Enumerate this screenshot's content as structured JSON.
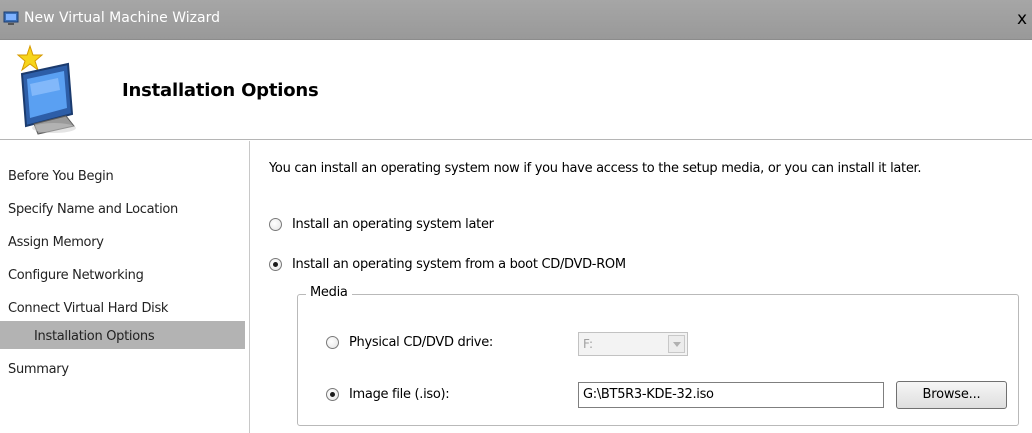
{
  "window": {
    "title": "New Virtual Machine Wizard",
    "close_label": "x"
  },
  "header": {
    "title": "Installation Options"
  },
  "sidebar": {
    "items": [
      {
        "label": "Before You Begin"
      },
      {
        "label": "Specify Name and Location"
      },
      {
        "label": "Assign Memory"
      },
      {
        "label": "Configure Networking"
      },
      {
        "label": "Connect Virtual Hard Disk"
      },
      {
        "label": "Installation Options",
        "active": true
      },
      {
        "label": "Summary"
      }
    ]
  },
  "content": {
    "intro": "You can install an operating system now if you have access to the setup media, or you can install it later.",
    "option_later": {
      "label": "Install an operating system later",
      "selected": false
    },
    "option_boot": {
      "label": "Install an operating system from a boot CD/DVD-ROM",
      "selected": true
    },
    "media": {
      "legend": "Media",
      "physical": {
        "label": "Physical CD/DVD drive:",
        "selected": false,
        "drive_value": "F:"
      },
      "image": {
        "label": "Image file (.iso):",
        "selected": true,
        "path_value": "G:\\BT5R3-KDE-32.iso"
      },
      "browse_label": "Browse..."
    }
  }
}
